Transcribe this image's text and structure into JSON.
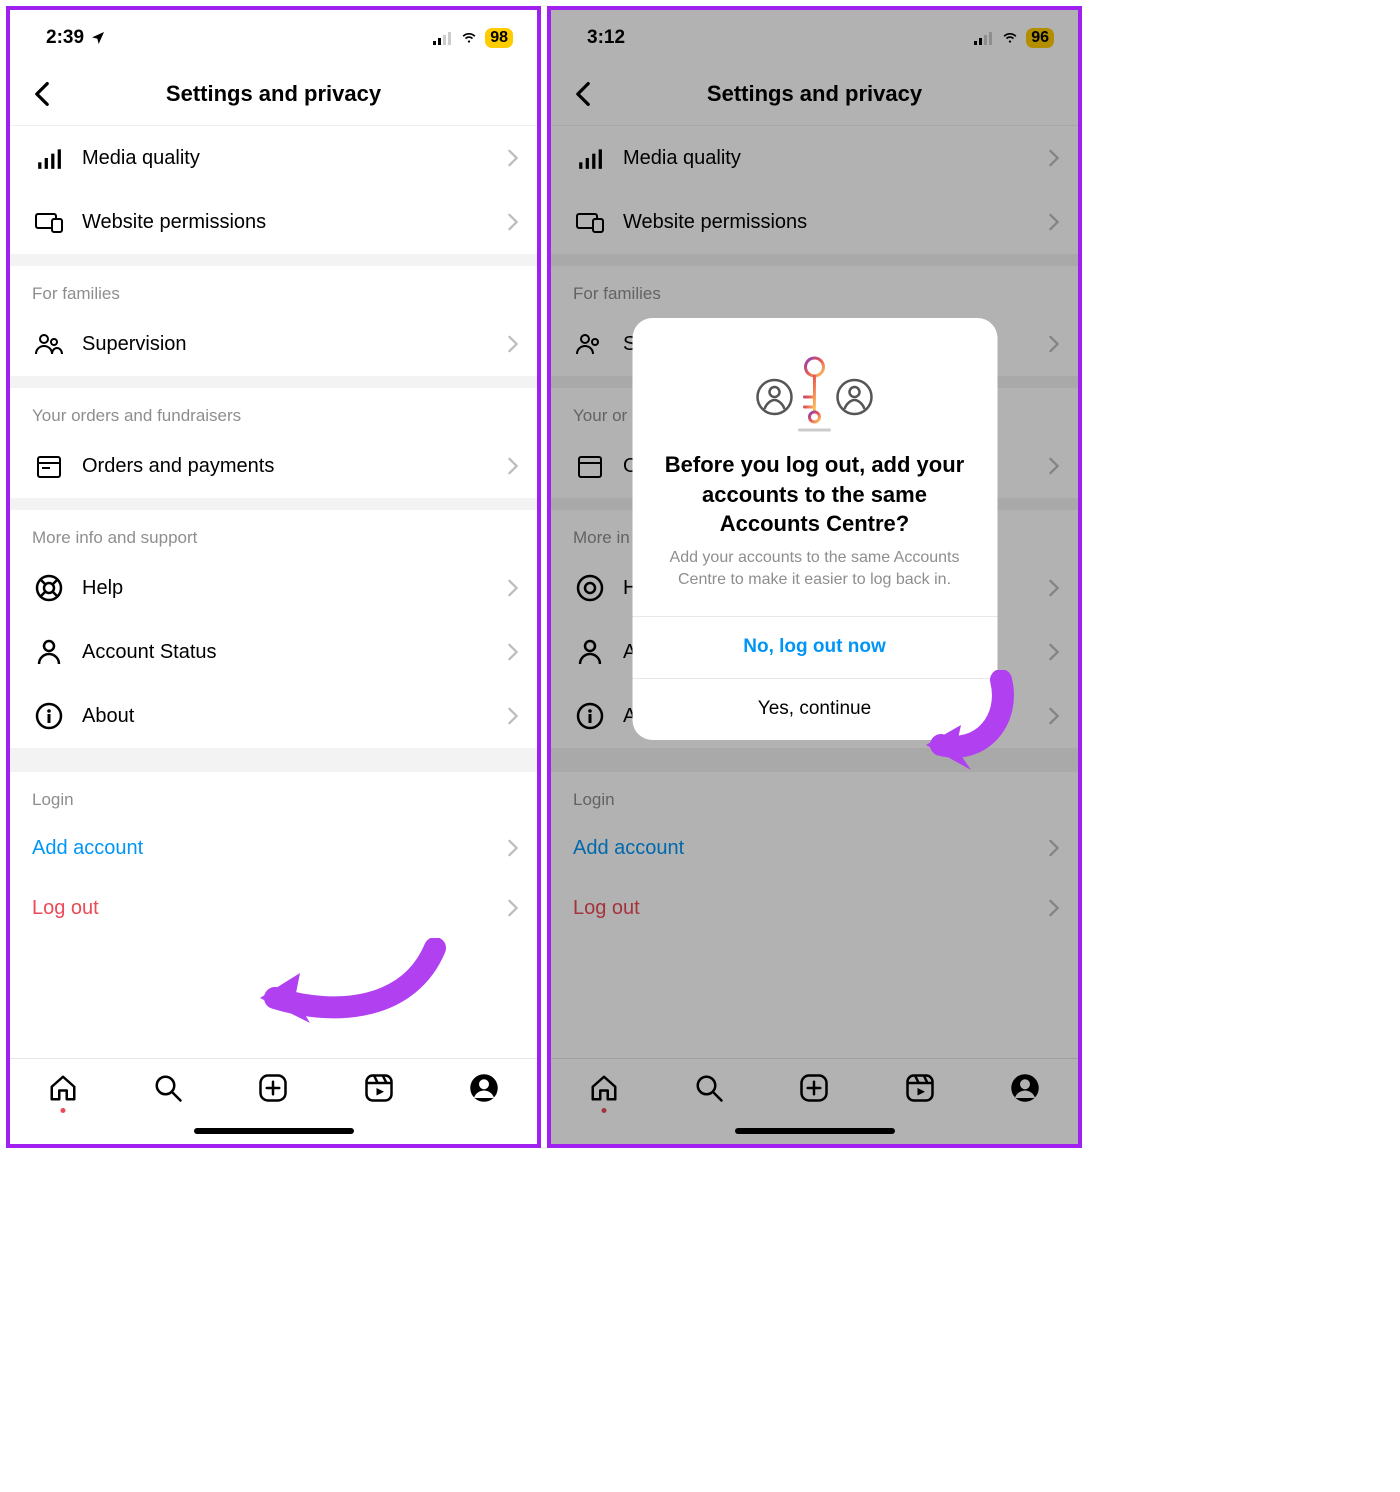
{
  "left": {
    "status": {
      "time": "2:39",
      "battery": "98"
    },
    "title": "Settings and privacy",
    "items_top": [
      {
        "label": "Media quality",
        "icon": "bars"
      },
      {
        "label": "Website permissions",
        "icon": "devices"
      }
    ],
    "section_families": "For families",
    "items_families": [
      {
        "label": "Supervision",
        "icon": "people"
      }
    ],
    "section_orders": "Your orders and fundraisers",
    "items_orders": [
      {
        "label": "Orders and payments",
        "icon": "box"
      }
    ],
    "section_info": "More info and support",
    "items_info": [
      {
        "label": "Help",
        "icon": "lifebuoy"
      },
      {
        "label": "Account Status",
        "icon": "person"
      },
      {
        "label": "About",
        "icon": "info"
      }
    ],
    "section_login": "Login",
    "add_account": "Add account",
    "log_out": "Log out"
  },
  "right": {
    "status": {
      "time": "3:12",
      "battery": "96"
    },
    "title": "Settings and privacy",
    "modal": {
      "title": "Before you log out, add your accounts to the same Accounts Centre?",
      "desc": "Add your accounts to the same Accounts Centre to make it easier to log back in.",
      "primary": "No, log out now",
      "secondary": "Yes, continue"
    },
    "items_top": [
      {
        "label": "Media quality"
      },
      {
        "label": "Website permissions"
      }
    ],
    "section_families": "For families",
    "supervision_initial": "S",
    "section_orders_partial": "Your or",
    "orders_initial": "O",
    "section_info_partial": "More in",
    "info_initials": [
      "H",
      "A",
      "A"
    ],
    "section_login": "Login",
    "add_account": "Add account",
    "log_out": "Log out"
  }
}
